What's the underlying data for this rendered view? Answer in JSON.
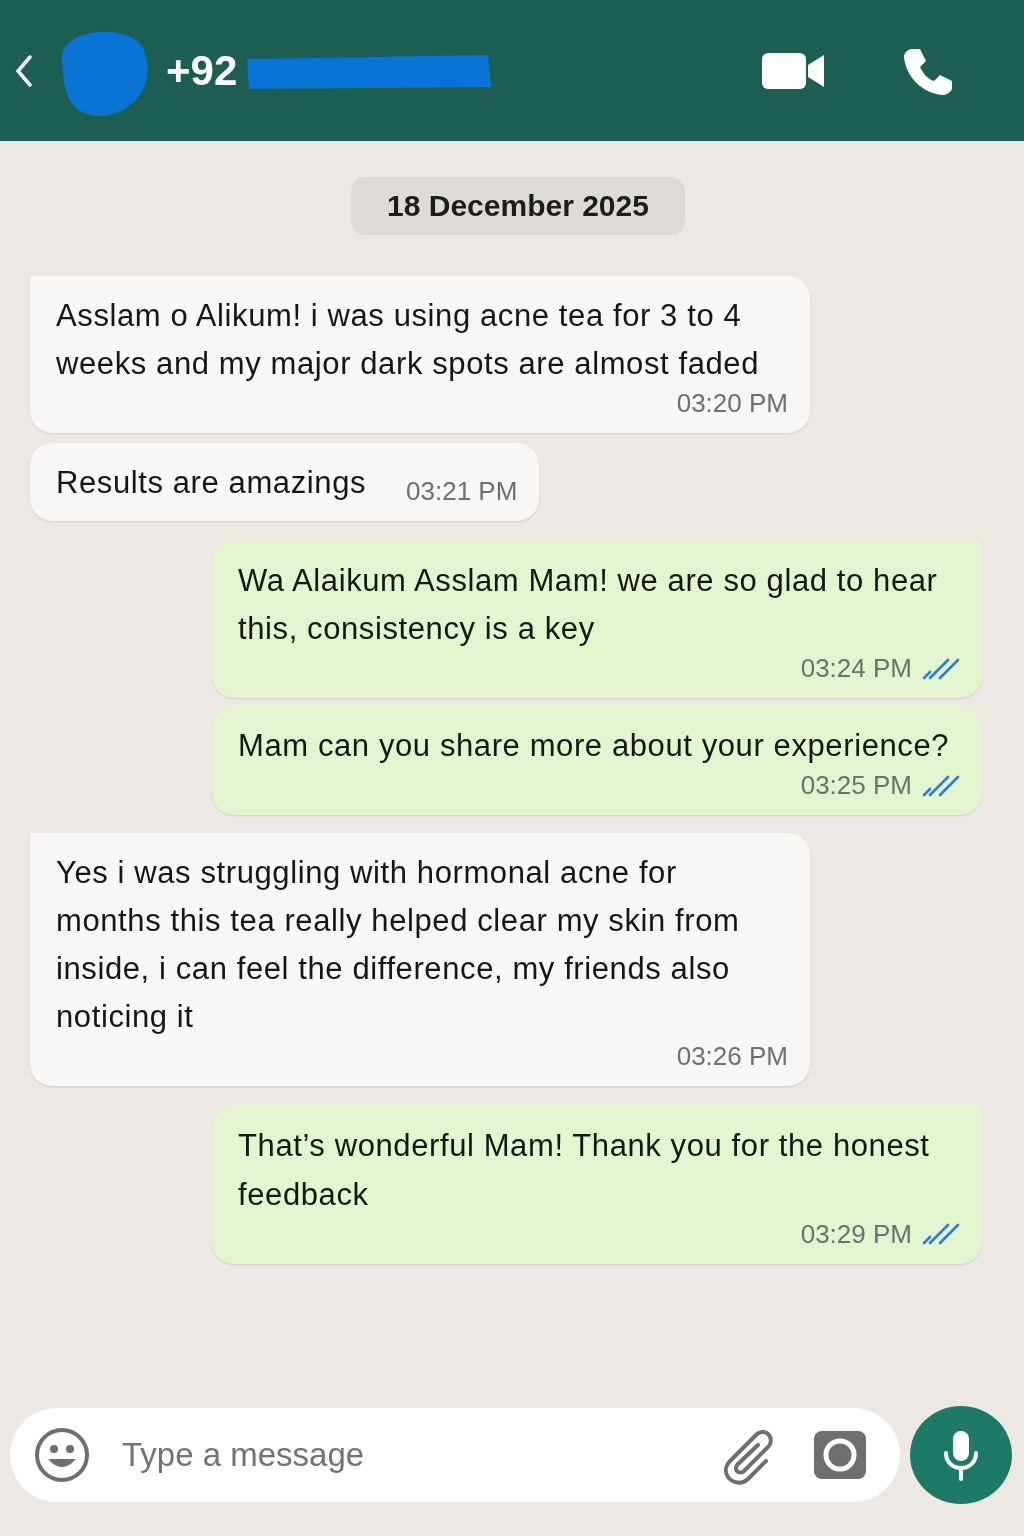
{
  "header": {
    "phone": "+92"
  },
  "date_chip": "18 December 2025",
  "messages": [
    {
      "kind": "incoming",
      "tail": true,
      "text": "Asslam o Alikum! i was using acne tea for 3 to 4 weeks and my major dark spots are almost faded",
      "time": "03:20 PM"
    },
    {
      "kind": "incoming",
      "tail": false,
      "text": "Results are amazings",
      "time": "03:21 PM"
    },
    {
      "kind": "outgoing",
      "tail": true,
      "text": "Wa Alaikum Asslam Mam! we are so glad to hear this, consistency is a key",
      "time": "03:24 PM",
      "read": true
    },
    {
      "kind": "outgoing",
      "tail": false,
      "text": "Mam can you share more about your experience?",
      "time": "03:25 PM",
      "read": true
    },
    {
      "kind": "incoming",
      "tail": true,
      "text": "Yes i was struggling with hormonal acne for months this tea really helped clear my skin from inside, i can feel the difference, my friends also noticing it",
      "time": "03:26 PM"
    },
    {
      "kind": "outgoing",
      "tail": true,
      "text": "That’s wonderful Mam! Thank you for the honest feedback",
      "time": "03:29 PM",
      "read": true
    }
  ],
  "composer": {
    "placeholder": "Type a message"
  }
}
